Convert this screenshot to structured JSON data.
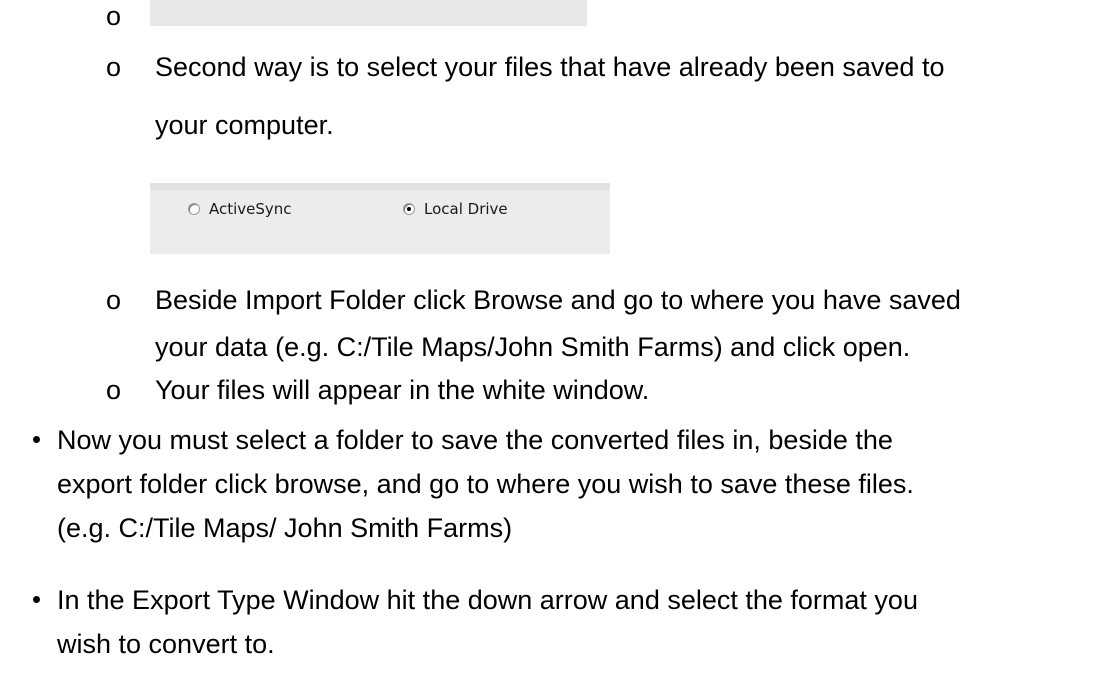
{
  "bullets": {
    "sub_marker": "o",
    "main_marker": "•"
  },
  "lines": {
    "second_way_1": "Second way is to select your files that have already been saved to",
    "second_way_2": "your computer.",
    "import_folder_1": "Beside Import Folder click Browse and go to where you have saved",
    "import_folder_2": "your data (e.g. C:/Tile Maps/John Smith Farms) and click open.",
    "files_appear": "Your files will appear in the white window.",
    "export_1": "Now you must select a folder to save the converted files in, beside the",
    "export_2": "export folder click browse, and go to where you wish to save these files.",
    "export_3": "(e.g. C:/Tile Maps/ John Smith Farms)",
    "export_type_1": "In the Export Type Window hit the down arrow and select the format you",
    "export_type_2": "wish to convert to."
  },
  "source_options": [
    {
      "label": "ActiveSync",
      "selected": false
    },
    {
      "label": "Local Drive",
      "selected": true
    }
  ]
}
